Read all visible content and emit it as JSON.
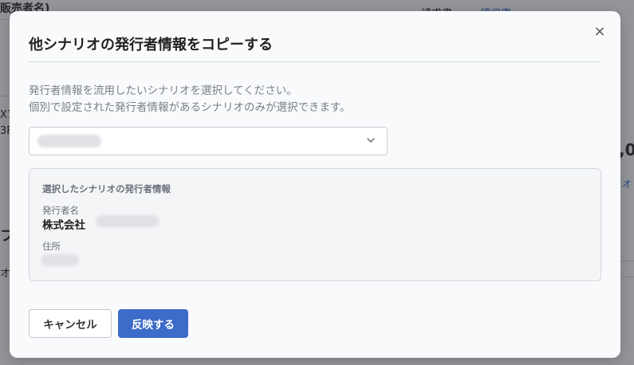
{
  "background": {
    "heading": "販売者名)",
    "tab_invoice": "請求書",
    "tab_receipt": "領収書",
    "side_amount": ",0",
    "side_link": "オ",
    "left_fragments": [
      "X7",
      "3F",
      "フ",
      "オ"
    ]
  },
  "modal": {
    "title": "他シナリオの発行者情報をコピーする",
    "close_icon": "×",
    "description": [
      "発行者情報を流用したいシナリオを選択してください。",
      "個別で設定された発行者情報があるシナリオのみが選択できます。"
    ],
    "select": {
      "chevron_icon": "chevron-down-icon"
    },
    "panel": {
      "heading": "選択したシナリオの発行者情報",
      "issuer_name_label": "発行者名",
      "issuer_name_value": "株式会社",
      "address_label": "住所"
    },
    "buttons": {
      "cancel": "キャンセル",
      "apply": "反映する"
    },
    "colors": {
      "primary": "#3d6bc9",
      "overlay": "rgba(40,44,52,0.5)"
    }
  }
}
